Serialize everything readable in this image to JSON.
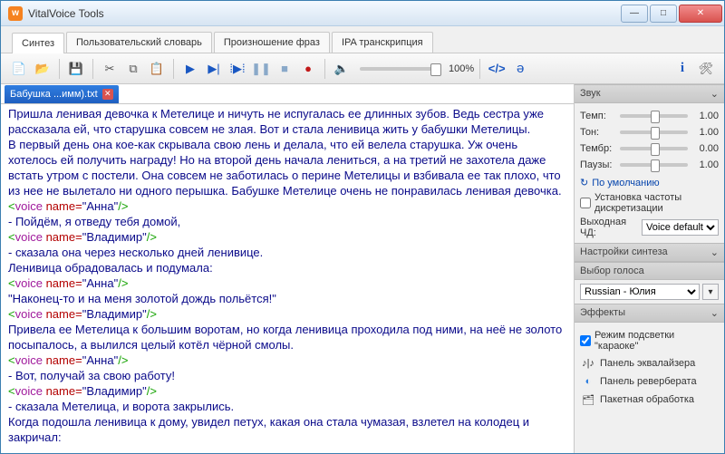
{
  "window": {
    "title": "VitalVoice Tools"
  },
  "tabs": [
    {
      "label": "Синтез",
      "active": true
    },
    {
      "label": "Пользовательский словарь",
      "active": false
    },
    {
      "label": "Произношение фраз",
      "active": false
    },
    {
      "label": "IPA транскрипция",
      "active": false
    }
  ],
  "toolbar": {
    "new": "new-file-icon",
    "open": "open-folder-icon",
    "save": "save-icon",
    "cut": "cut-icon",
    "copy": "copy-icon",
    "paste": "paste-icon",
    "play": "play-icon",
    "play_cursor": "play-from-cursor-icon",
    "play_sel": "play-selection-icon",
    "pause": "pause-icon",
    "stop": "stop-icon",
    "record": "record-icon",
    "volume": "volume-icon",
    "zoom": "100%",
    "tags": "insert-tag-icon",
    "phoneme": "phoneme-icon",
    "info": "info-icon",
    "settings": "settings-icon"
  },
  "file_tab": {
    "name": "Бабушка ...имм).txt"
  },
  "editor": {
    "p1": "Пришла ленивая девочка к Метелице и ничуть не испугалась ее длинных зубов. Ведь сестра уже рассказала ей, что старушка совсем не злая. Вот и стала ленивица жить у бабушки Метелицы.",
    "p2": "В первый день она кое-как скрывала свою лень и делала, что ей велела старушка. Уж очень хотелось ей получить награду! Но на второй день начала лениться, а на третий не захотела даже встать утром с постели. Она совсем не заботилась о перине Метелицы и взбивала ее так плохо, что из нее не вылетало ни одного перышка. Бабушке Метелице очень не понравилась ленивая девочка.",
    "voice_anna": "Анна",
    "voice_vlad": "Владимир",
    "l1": "- Пойдём, я отведу тебя домой,",
    "l2": "- сказала она через несколько дней ленивице.",
    "l3": "Ленивица обрадовалась и подумала:",
    "l4": " \"Наконец-то и на меня золотой дождь польётся!\"",
    "l5": "Привела ее Метелица к большим воротам, но когда ленивица проходила под ними, на неё не золото посыпалось, а вылился целый котёл чёрной смолы.",
    "l6": "- Вот, получай за свою работу!",
    "l7": "- сказала Метелица, и ворота закрылись.",
    "l8": "Когда подошла ленивица к дому, увидел петух, какая она стала чумазая, взлетел на колодец и закричал:"
  },
  "sound_panel": {
    "header": "Звук",
    "tempo_lbl": "Темп:",
    "tempo_val": "1.00",
    "tone_lbl": "Тон:",
    "tone_val": "1.00",
    "timbre_lbl": "Тембр:",
    "timbre_val": "0.00",
    "pause_lbl": "Паузы:",
    "pause_val": "1.00",
    "defaults": "По умолчанию",
    "freq_ck": "Установка частоты дискретизации",
    "freq_lbl": "Выходная ЧД:",
    "freq_val": "Voice default"
  },
  "synth_panel": {
    "header": "Настройки синтеза"
  },
  "voice_panel": {
    "header": "Выбор голоса",
    "selected": "Russian - Юлия"
  },
  "fx_panel": {
    "header": "Эффекты",
    "karaoke": "Режим подсветки \"караоке\"",
    "eq": "Панель эквалайзера",
    "reverb": "Панель реверберата",
    "batch": "Пакетная обработка"
  }
}
